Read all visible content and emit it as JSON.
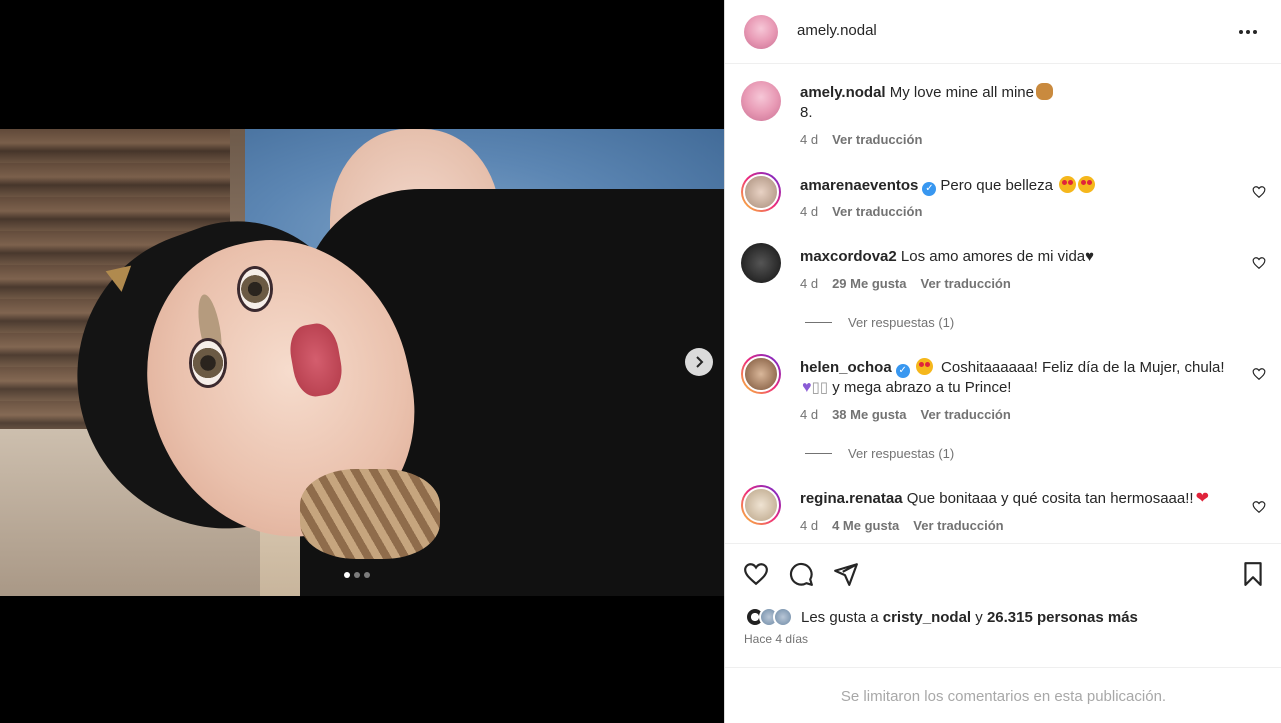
{
  "post": {
    "author": "amely.nodal",
    "caption_text": "My love mine all mine",
    "caption_line2": "8.",
    "caption_time": "4 d",
    "see_translation": "Ver traducción",
    "carousel": {
      "total": 3,
      "active": 1
    }
  },
  "comments": [
    {
      "user": "amarenaeventos",
      "verified": true,
      "text": "Pero que belleza",
      "time": "4 d",
      "likes": "",
      "translate": "Ver traducción"
    },
    {
      "user": "maxcordova2",
      "verified": false,
      "text": "Los amo amores de mi vida♥",
      "time": "4 d",
      "likes": "29 Me gusta",
      "translate": "Ver traducción",
      "replies": "Ver respuestas (1)"
    },
    {
      "user": "helen_ochoa",
      "verified": true,
      "text": "Coshitaaaaaa! Feliz día de la Mujer, chula!",
      "text2": "y mega abrazo a tu Prince!",
      "time": "4 d",
      "likes": "38 Me gusta",
      "translate": "Ver traducción",
      "replies": "Ver respuestas (1)"
    },
    {
      "user": "regina.renataa",
      "verified": false,
      "text": "Que bonitaaa y qué cosita tan hermosaaa!!",
      "time": "4 d",
      "likes": "4 Me gusta",
      "translate": "Ver traducción"
    }
  ],
  "likes_summary": {
    "prefix": "Les gusta a",
    "first_user": "cristy_nodal",
    "and": "y",
    "others": "26.315 personas más"
  },
  "time_ago": "Hace 4 días",
  "comments_limited": "Se limitaron los comentarios en esta publicación.",
  "icons": [
    "heart-icon",
    "comment-icon",
    "share-icon",
    "bookmark-icon",
    "chevron-right-icon",
    "more-icon",
    "verified-icon"
  ],
  "colors": {
    "verified": "#3897f0",
    "meta_gray": "#737373",
    "border": "#dbdbdb"
  }
}
